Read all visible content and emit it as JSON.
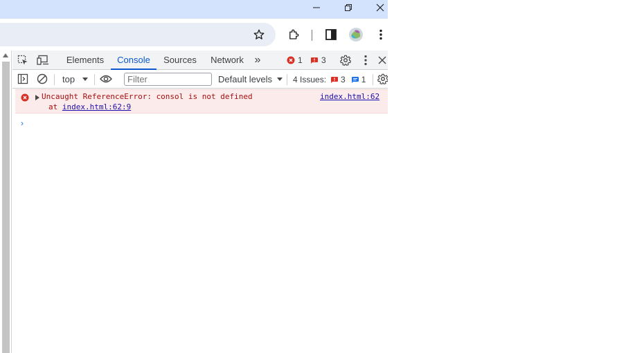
{
  "window": {
    "controls": {
      "minimize": "minimize-icon",
      "restore": "restore-icon",
      "close": "close-icon"
    }
  },
  "toolbar": {
    "icons": [
      "star-icon",
      "extensions-icon",
      "side-panel-icon",
      "profile-avatar",
      "menu-icon"
    ]
  },
  "devtools": {
    "tabs": [
      {
        "label": "Elements",
        "active": false
      },
      {
        "label": "Console",
        "active": true
      },
      {
        "label": "Sources",
        "active": false
      },
      {
        "label": "Network",
        "active": false
      }
    ],
    "more_tabs_glyph": "»",
    "error_count": "1",
    "warning_count": "3",
    "console_toolbar": {
      "context": "top",
      "filter_placeholder": "Filter",
      "levels": "Default levels",
      "issues_label": "4 Issues:",
      "issues_error_count": "3",
      "issues_info_count": "1"
    },
    "messages": [
      {
        "level": "error",
        "text": "Uncaught ReferenceError: consol is not defined",
        "source": "index.html:62",
        "stack_prefix": "at ",
        "stack_link": "index.html:62:9"
      }
    ],
    "prompt_glyph": "›"
  },
  "colors": {
    "titlebar": "#d3e3fd",
    "accent": "#0b57d0",
    "error": "#d93025",
    "error_bg": "#fcebeb",
    "link": "#1a0dab"
  }
}
